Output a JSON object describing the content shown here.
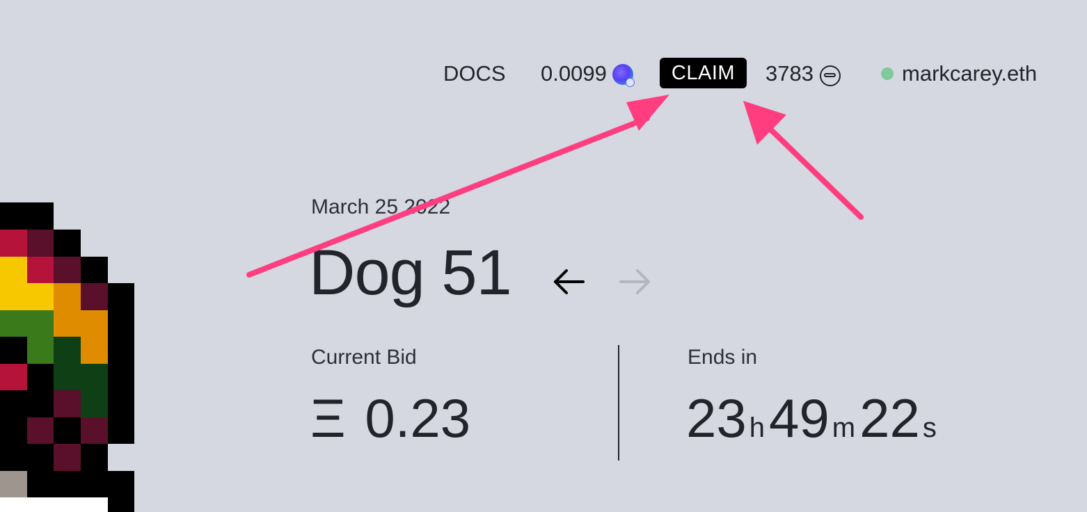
{
  "nav": {
    "docs_label": "DOCS",
    "balance_value": "0.0099",
    "balance_icon": "token-coin-icon",
    "claim_label": "CLAIM",
    "bones_value": "3783",
    "bones_icon": "bone-token-icon",
    "account_name": "markcarey.eth",
    "account_status_color": "#7fc99a"
  },
  "auction": {
    "date": "March 25 2022",
    "title": "Dog 51",
    "prev_icon": "arrow-left-icon",
    "next_icon": "arrow-right-icon",
    "next_disabled": true,
    "current_bid_label": "Current Bid",
    "current_bid_symbol": "Ξ",
    "current_bid_value": "0.23",
    "ends_in_label": "Ends in",
    "countdown": {
      "hours": "23",
      "hours_unit": "h",
      "minutes": "49",
      "minutes_unit": "m",
      "seconds": "22",
      "seconds_unit": "s"
    }
  },
  "colors": {
    "background": "#d5d7e1",
    "text": "#22242c",
    "annotation_arrow": "#ff3d7f",
    "claim_bg": "#000000"
  }
}
